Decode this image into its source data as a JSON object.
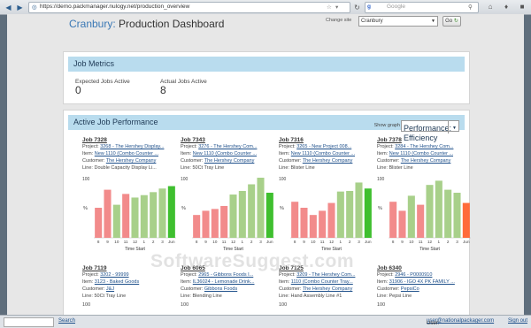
{
  "browser": {
    "url": "https://demo.packmanager.nulogy.net/production_overview",
    "search_placeholder": "Google",
    "search_engine": "Google"
  },
  "header": {
    "brand": "Cranbury:",
    "title": "Production Dashboard",
    "change_site_label": "Change site",
    "site_value": "Cranbury",
    "go_label": "Go"
  },
  "metrics": {
    "heading": "Job Metrics",
    "expected_label": "Expected Jobs Active",
    "expected_value": "0",
    "actual_label": "Actual Jobs Active",
    "actual_value": "8"
  },
  "performance": {
    "heading": "Active Job Performance",
    "show_graph_label": "Show graph",
    "graph_value": "Performance: Efficiency"
  },
  "jobs": [
    {
      "title": "Job 7328",
      "project_label": "Project:",
      "project": "3268 - The Hershey Display...",
      "item_label": "Item:",
      "item": "New 1110 (Combo Counter ...",
      "customer_label": "Customer:",
      "customer": "The Hershey Company",
      "line_label": "Line:",
      "line": "Double Capacity Display Li..."
    },
    {
      "title": "Job 7343",
      "project_label": "Project:",
      "project": "3276 - The Hershey Com...",
      "item_label": "Item:",
      "item": "New 1110 (Combo Counter ...",
      "customer_label": "Customer:",
      "customer": "The Hershey Company",
      "line_label": "Line:",
      "line": "50Ct Tray Line"
    },
    {
      "title": "Job 7316",
      "project_label": "Project:",
      "project": "3265 - New Project 008...",
      "item_label": "Item:",
      "item": "New 1110 (Combo Counter ...",
      "customer_label": "Customer:",
      "customer": "The Hershey Company",
      "line_label": "Line:",
      "line": "Blister Line"
    },
    {
      "title": "Job 7378",
      "project_label": "Project:",
      "project": "3284 - The Hershey Com...",
      "item_label": "Item:",
      "item": "New 1110 (Combo Counter ...",
      "customer_label": "Customer:",
      "customer": "The Hershey Company",
      "line_label": "Line:",
      "line": "Blister Line"
    },
    {
      "title": "Job 7119",
      "project_label": "Project:",
      "project": "3202 - 99999",
      "item_label": "Item:",
      "item": "3123 - Baked Goods",
      "customer_label": "Customer:",
      "customer": "J&J",
      "line_label": "Line:",
      "line": "50Ct Tray Line"
    },
    {
      "title": "Job 6065",
      "project_label": "Project:",
      "project": "2965 - Gibbons Foods I...",
      "item_label": "Item:",
      "item": "IL36024 - Lemonade Drink...",
      "customer_label": "Customer:",
      "customer": "Gibbons Foods",
      "line_label": "Line:",
      "line": "Blending Line"
    },
    {
      "title": "Job 7125",
      "project_label": "Project:",
      "project": "3209 - The Hershey Com...",
      "item_label": "Item:",
      "item": "1110 (Combo Counter Tray...",
      "customer_label": "Customer:",
      "customer": "The Hershey Company",
      "line_label": "Line:",
      "line": "Hand Assembly Line #1"
    },
    {
      "title": "Job 6340",
      "project_label": "Project:",
      "project": "2946 - P0000910",
      "item_label": "Item:",
      "item": "31906 - IGO 4X PK FAMILY ...",
      "customer_label": "Customer:",
      "customer": "PepsiCo",
      "line_label": "Line:",
      "line": "Pepsi Line"
    }
  ],
  "chart_data": [
    {
      "type": "bar",
      "title": "",
      "xlabel": "Time Start",
      "ylabel": "%",
      "ylim": [
        0,
        100
      ],
      "y_tick": "100",
      "categories": [
        "8",
        "9",
        "10",
        "11",
        "12",
        "1",
        "2",
        "3",
        "Jun"
      ],
      "values": [
        50,
        80,
        55,
        73,
        67,
        71,
        76,
        82,
        86
      ],
      "bar_colors": [
        "#f28b8b",
        "#f28b8b",
        "#a8d08a",
        "#f28b8b",
        "#a8d08a",
        "#a8d08a",
        "#a8d08a",
        "#a8d08a",
        "#3fbf2f"
      ]
    },
    {
      "type": "bar",
      "title": "",
      "xlabel": "Time Start",
      "ylabel": "%",
      "ylim": [
        0,
        100
      ],
      "y_tick": "100",
      "categories": [
        "8",
        "9",
        "10",
        "11",
        "12",
        "1",
        "2",
        "3",
        "Jun"
      ],
      "values": [
        38,
        45,
        48,
        53,
        72,
        78,
        89,
        100,
        75
      ],
      "bar_colors": [
        "#f28b8b",
        "#f28b8b",
        "#f28b8b",
        "#f28b8b",
        "#a8d08a",
        "#a8d08a",
        "#a8d08a",
        "#a8d08a",
        "#3fbf2f"
      ]
    },
    {
      "type": "bar",
      "title": "",
      "xlabel": "Time Start",
      "ylabel": "%",
      "ylim": [
        0,
        100
      ],
      "y_tick": "100",
      "categories": [
        "8",
        "9",
        "10",
        "11",
        "12",
        "1",
        "2",
        "3",
        "Jun"
      ],
      "values": [
        60,
        50,
        38,
        45,
        58,
        77,
        78,
        92,
        82
      ],
      "bar_colors": [
        "#f28b8b",
        "#f28b8b",
        "#f28b8b",
        "#f28b8b",
        "#f28b8b",
        "#a8d08a",
        "#a8d08a",
        "#a8d08a",
        "#3fbf2f"
      ]
    },
    {
      "type": "bar",
      "title": "",
      "xlabel": "Time Start",
      "ylabel": "%",
      "ylim": [
        0,
        100
      ],
      "y_tick": "100",
      "categories": [
        "8",
        "9",
        "10",
        "11",
        "12",
        "1",
        "2",
        "3",
        "Jun"
      ],
      "values": [
        60,
        45,
        70,
        55,
        88,
        95,
        80,
        75,
        58
      ],
      "bar_colors": [
        "#f28b8b",
        "#f28b8b",
        "#a8d08a",
        "#f28b8b",
        "#a8d08a",
        "#a8d08a",
        "#a8d08a",
        "#a8d08a",
        "#ff6b3a"
      ]
    }
  ],
  "bottom_charts": {
    "y_tick": "100"
  },
  "footer": {
    "search_label": "Search",
    "user_label": "User:",
    "user_email": "user@nationalpackager.com",
    "sign_out_label": "Sign out"
  },
  "watermark": "SoftwareSuggest.com",
  "colors": {
    "accent": "#3a78b5",
    "header_band": "#b9dcee",
    "bar_red": "#f28b8b",
    "bar_green": "#a8d08a",
    "bar_dark_green": "#3fbf2f"
  }
}
